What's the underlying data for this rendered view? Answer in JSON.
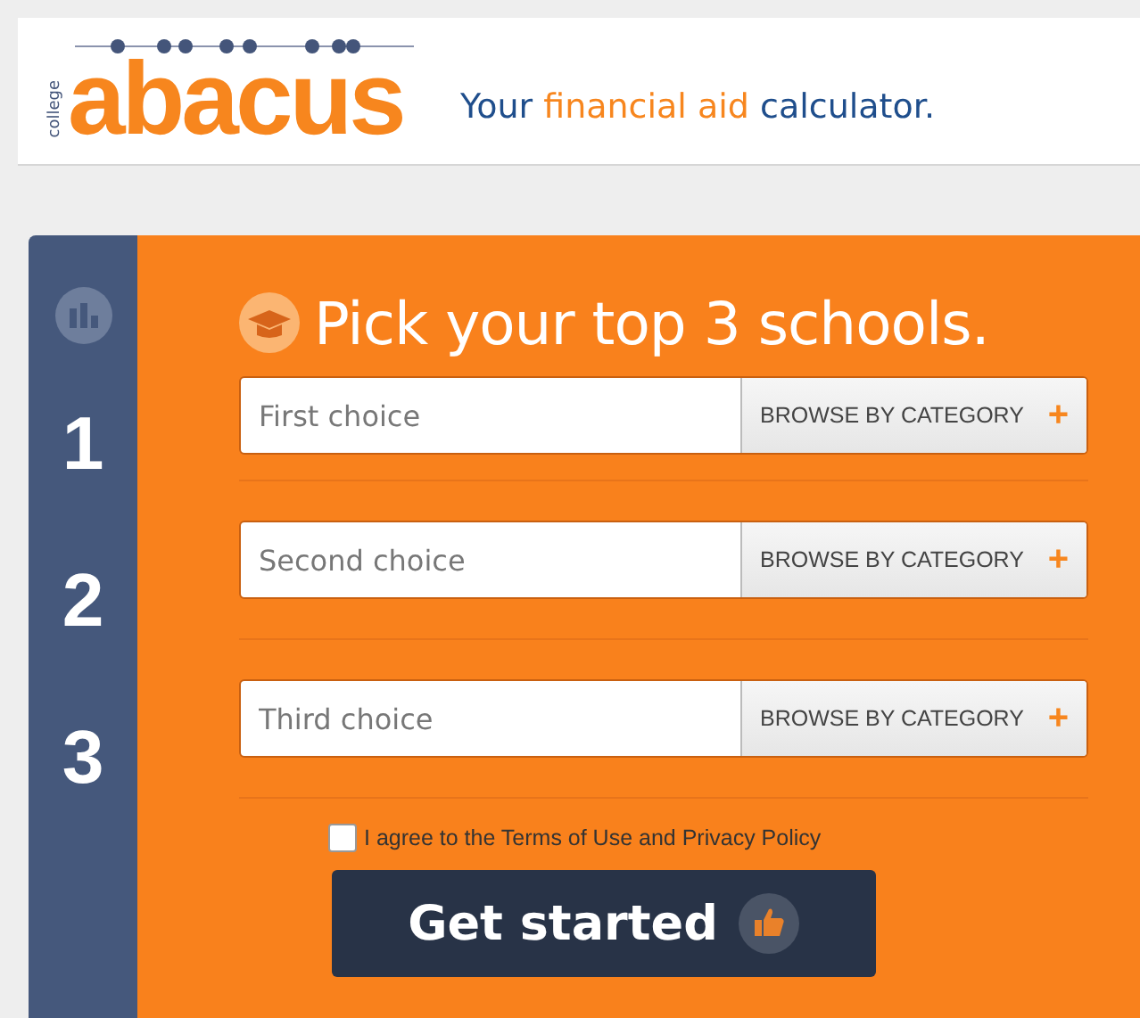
{
  "header": {
    "logo": {
      "prefix": "college",
      "name": "abacus"
    },
    "tagline": [
      {
        "text": "Your ",
        "highlight": false
      },
      {
        "text": "financial aid",
        "highlight": true
      },
      {
        "text": " calculator.",
        "highlight": false
      }
    ]
  },
  "form": {
    "title": "Pick your top 3 schools.",
    "choices": [
      {
        "number": "1",
        "placeholder": "First choice",
        "button": "BROWSE BY CATEGORY",
        "button_icon": "+"
      },
      {
        "number": "2",
        "placeholder": "Second choice",
        "button": "BROWSE BY CATEGORY",
        "button_icon": "+"
      },
      {
        "number": "3",
        "placeholder": "Third choice",
        "button": "BROWSE BY CATEGORY",
        "button_icon": "+"
      }
    ],
    "agree": {
      "label": "I agree to the Terms of Use and Privacy Policy",
      "checked": false
    },
    "submit": "Get started"
  }
}
